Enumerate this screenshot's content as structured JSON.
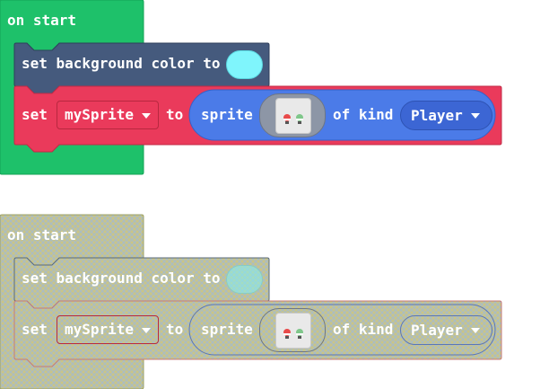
{
  "group_active": {
    "hat_label": "on start",
    "bg_block": {
      "label": "set background color to",
      "color_value": "#7ff5fc"
    },
    "set_block": {
      "set_label": "set",
      "variable": "mySprite",
      "to_label": "to",
      "sprite_label": "sprite",
      "of_kind_label": "of kind",
      "kind": "Player"
    }
  },
  "group_disabled": {
    "hat_label": "on start",
    "bg_block": {
      "label": "set background color to",
      "color_value": "#7ff5fc"
    },
    "set_block": {
      "set_label": "set",
      "variable": "mySprite",
      "to_label": "to",
      "sprite_label": "sprite",
      "of_kind_label": "of kind",
      "kind": "Player"
    }
  },
  "colors": {
    "events_green": "#1ec16a",
    "scene_blue": "#455a7d",
    "variables_red": "#ea3a5b",
    "sprites_blue": "#4b7be8",
    "disabled_hatch": "#c8c48a"
  },
  "icons": [
    "dropdown-caret-icon",
    "sprite-thumbnail-icon",
    "color-swatch-icon"
  ]
}
